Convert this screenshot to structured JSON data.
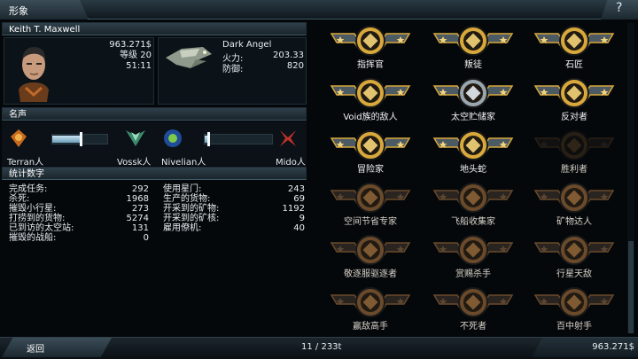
{
  "header": {
    "title": "形象",
    "help_icon": "?"
  },
  "pilot": {
    "name": "Keith T. Maxwell",
    "credits": "963.271$",
    "level": "等级 20",
    "time": "51:11"
  },
  "ship": {
    "name": "Dark Angel",
    "firepower_label": "火力:",
    "firepower": "203.33",
    "defense_label": "防御:",
    "defense": "820"
  },
  "reputation": {
    "title": "名声",
    "left_pair": {
      "a": "Terran人",
      "b": "Vossk人",
      "level": 0.52
    },
    "right_pair": {
      "a": "Nivelian人",
      "b": "Mido人",
      "level": 0.05
    }
  },
  "statistics": {
    "title": "统计数字",
    "left": [
      {
        "label": "完成任务:",
        "value": "292"
      },
      {
        "label": "杀死:",
        "value": "1968"
      },
      {
        "label": "摧毁小行星:",
        "value": "273"
      },
      {
        "label": "打捞到的货物:",
        "value": "5274"
      },
      {
        "label": "已到访的太空站:",
        "value": "131"
      },
      {
        "label": "摧毁的战船:",
        "value": "0"
      }
    ],
    "right": [
      {
        "label": "使用星门:",
        "value": "243"
      },
      {
        "label": "生产的货物:",
        "value": "69"
      },
      {
        "label": "开采到的矿物:",
        "value": "1192"
      },
      {
        "label": "开采到的矿核:",
        "value": "9"
      },
      {
        "label": "雇用僚机:",
        "value": "40"
      }
    ]
  },
  "medals": [
    {
      "label": "指挥官",
      "icon": "commander-emblem-icon",
      "earned": true
    },
    {
      "label": "叛徒",
      "icon": "traitor-emblem-icon",
      "earned": true
    },
    {
      "label": "石匠",
      "icon": "mason-emblem-icon",
      "earned": true
    },
    {
      "label": "Void族的敌人",
      "icon": "void-enemy-emblem-icon",
      "earned": true
    },
    {
      "label": "太空贮储家",
      "icon": "space-hoarder-emblem-icon",
      "earned": true
    },
    {
      "label": "反对者",
      "icon": "opposer-emblem-icon",
      "earned": true
    },
    {
      "label": "冒险家",
      "icon": "adventurer-emblem-icon",
      "earned": true
    },
    {
      "label": "地头蛇",
      "icon": "local-boss-emblem-icon",
      "earned": true
    },
    {
      "label": "胜利者",
      "icon": "victor-emblem-icon",
      "earned": false
    },
    {
      "label": "空间节省专家",
      "icon": "space-saver-emblem-icon",
      "earned": false
    },
    {
      "label": "飞船收集家",
      "icon": "ship-collector-emblem-icon",
      "earned": false
    },
    {
      "label": "矿物达人",
      "icon": "mineral-master-emblem-icon",
      "earned": false
    },
    {
      "label": "敬逐服驱逐者",
      "icon": "chaser-emblem-icon",
      "earned": false
    },
    {
      "label": "赏赐杀手",
      "icon": "bounty-killer-emblem-icon",
      "earned": false
    },
    {
      "label": "行星天敌",
      "icon": "planet-foe-emblem-icon",
      "earned": false
    },
    {
      "label": "赢敌高手",
      "icon": "victory-expert-emblem-icon",
      "earned": false
    },
    {
      "label": "不死者",
      "icon": "undying-emblem-icon",
      "earned": false
    },
    {
      "label": "百中射手",
      "icon": "sharpshooter-emblem-icon",
      "earned": false
    }
  ],
  "footer": {
    "back": "返回",
    "page": "11 / 233t",
    "credits": "963.271$"
  }
}
